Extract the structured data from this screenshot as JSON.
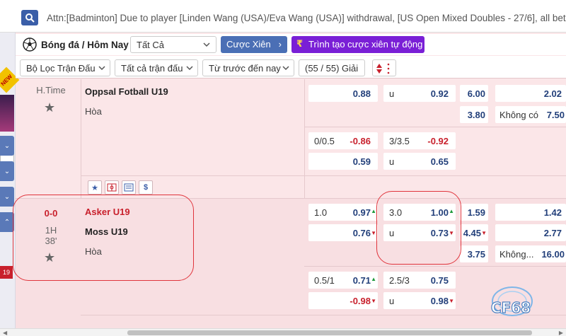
{
  "marquee": "Attn:[Badminton] Due to player [Linden Wang (USA)/Eva Wang (USA)] withdrawal, [US Open Mixed Doubles - 27/6], all bets taken",
  "header": {
    "sport": "Bóng đá / Hôm Nay",
    "filter_all": "Tất Cả",
    "cuoc_xien": "Cược Xiên",
    "trinh_tao": "Trình tạo cược xiên tự động",
    "new_badge": "NEW"
  },
  "filters": {
    "match_filter": "Bộ Lọc Trận Đấu",
    "all_matches": "Tất cả trận đấu",
    "from_before": "Từ trước đến nay",
    "league_count": "(55 / 55) Giải"
  },
  "side": {
    "badge_num": "19"
  },
  "matches": [
    {
      "time": "H.Time",
      "team1": "Oppsal Fotball U19",
      "draw": "Hòa",
      "rows": [
        {
          "hdp_label": "",
          "hdp_val": "0.88",
          "ou_label": "u",
          "ou_val": "0.92",
          "x12": "6.00",
          "extra_label": "",
          "extra_val": "2.02"
        },
        {
          "hdp_label": "",
          "hdp_val": "",
          "ou_label": "",
          "ou_val": "",
          "x12": "3.80",
          "extra_label": "Không có",
          "extra_val": "7.50"
        },
        {
          "hdp_label": "0/0.5",
          "hdp_val": "-0.86",
          "ou_label": "3/3.5",
          "ou_val": "-0.92"
        },
        {
          "hdp_label": "",
          "hdp_val": "0.59",
          "ou_label": "u",
          "ou_val": "0.65"
        }
      ]
    },
    {
      "score": "0-0",
      "half": "1H",
      "minute": "38'",
      "team1": "Asker U19",
      "team2": "Moss U19",
      "draw": "Hòa",
      "rows": [
        {
          "hdp_label": "1.0",
          "hdp_val": "0.97",
          "ou_label": "3.0",
          "ou_val": "1.00",
          "x12": "1.59",
          "extra_label": "",
          "extra_val": "1.42"
        },
        {
          "hdp_label": "",
          "hdp_val": "0.76",
          "ou_label": "u",
          "ou_val": "0.73",
          "x12": "4.45",
          "extra_label": "",
          "extra_val": "2.77"
        },
        {
          "x12": "3.75",
          "extra_label": "Không...",
          "extra_val": "16.00"
        },
        {
          "hdp_label": "0.5/1",
          "hdp_val": "0.71",
          "ou_label": "2.5/3",
          "ou_val": "0.75"
        },
        {
          "hdp_label": "",
          "hdp_val": "-0.98",
          "ou_label": "u",
          "ou_val": "0.98"
        }
      ]
    }
  ],
  "watermark": "CF68",
  "colors": {
    "accent": "#4b6fb5",
    "purple": "#7a1fd6",
    "red": "#c8202c",
    "odds": "#223f7a",
    "up": "#1f9a3c"
  }
}
